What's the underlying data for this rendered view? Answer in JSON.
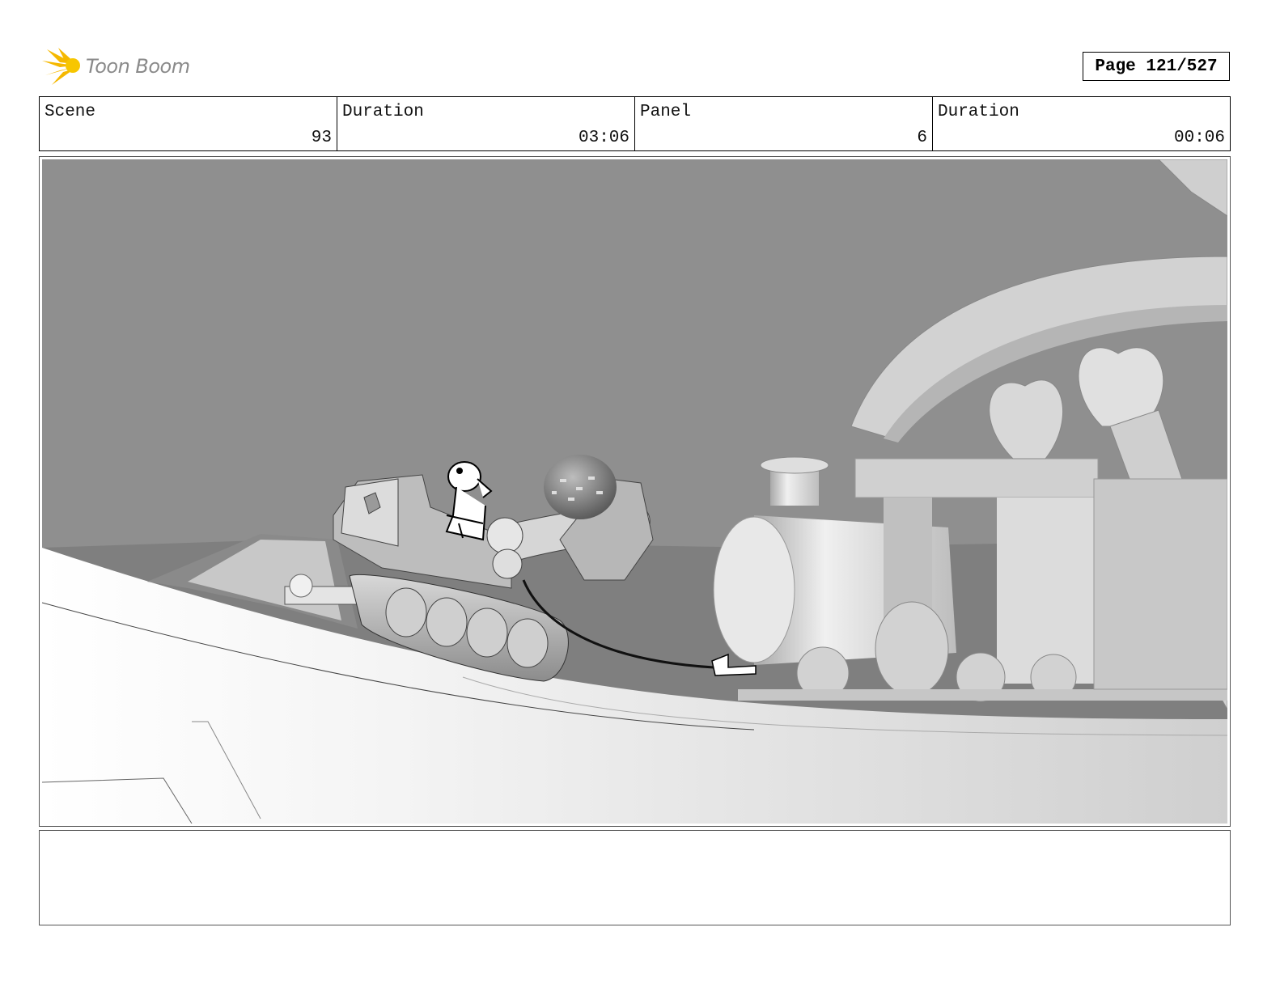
{
  "header": {
    "logo_text": "Toon Boom",
    "page_label": "Page 121/527"
  },
  "info": [
    {
      "label": "Scene",
      "value": "93"
    },
    {
      "label": "Duration",
      "value": "03:06"
    },
    {
      "label": "Panel",
      "value": "6"
    },
    {
      "label": "Duration",
      "value": "00:06"
    }
  ],
  "colors": {
    "logo_yellow": "#f5b800",
    "sky": "#8f8f8f",
    "frame": "#555555"
  },
  "notes": ""
}
